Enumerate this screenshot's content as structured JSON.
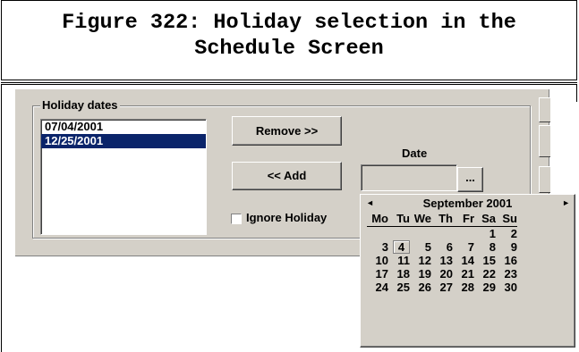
{
  "caption": {
    "line1": "Figure 322: Holiday selection in the",
    "line2": "Schedule Screen"
  },
  "dialog": {
    "group_label": "Holiday dates",
    "holiday_list": [
      "07/04/2001",
      "12/25/2001"
    ],
    "selected_index": 1,
    "remove_button": "Remove >>",
    "add_button": "<< Add",
    "date_label": "Date",
    "date_value": "",
    "ellipsis_button": "...",
    "ignore_holiday_label": "Ignore Holiday",
    "ignore_holiday_checked": false
  },
  "calendar": {
    "prev_icon": "◄",
    "next_icon": "►",
    "month_label": "September 2001",
    "weekdays": [
      "Mo",
      "Tu",
      "We",
      "Th",
      "Fr",
      "Sa",
      "Su"
    ],
    "weeks": [
      [
        "",
        "",
        "",
        "",
        "",
        "1",
        "2"
      ],
      [
        "3",
        "4",
        "5",
        "6",
        "7",
        "8",
        "9"
      ],
      [
        "10",
        "11",
        "12",
        "13",
        "14",
        "15",
        "16"
      ],
      [
        "17",
        "18",
        "19",
        "20",
        "21",
        "22",
        "23"
      ],
      [
        "24",
        "25",
        "26",
        "27",
        "28",
        "29",
        "30"
      ]
    ],
    "today": "4"
  },
  "colors": {
    "panel": "#d4d0c8",
    "selection": "#0a246a"
  }
}
